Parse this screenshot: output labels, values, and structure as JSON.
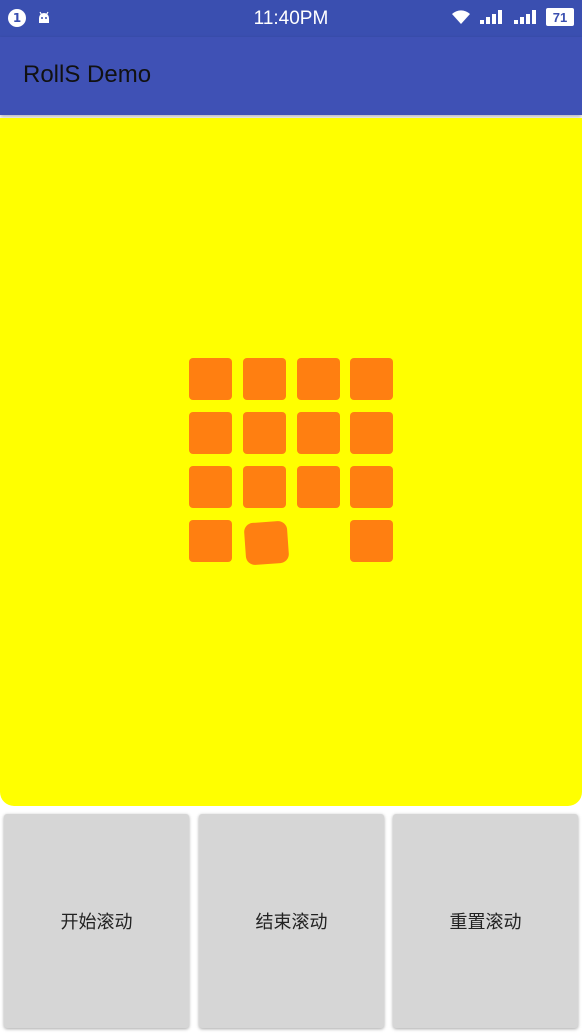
{
  "status_bar": {
    "notification_count": "1",
    "time": "11:40PM",
    "battery": "71",
    "icons": [
      "notification-badge",
      "android-icon",
      "wifi-icon",
      "signal-icon",
      "signal-icon",
      "battery-icon"
    ]
  },
  "app_bar": {
    "title": "RollS Demo"
  },
  "colors": {
    "status_bar": "#3a4fb0",
    "app_bar": "#3f51b5",
    "canvas": "#ffff00",
    "tile": "#ff7f11",
    "button": "#d6d6d6"
  },
  "grid": {
    "rows": 4,
    "columns": 4,
    "empty_cell": "row 4, column 3",
    "rolling_cell": "row 4, column 2"
  },
  "buttons": {
    "start": "开始滚动",
    "stop": "结束滚动",
    "reset": "重置滚动"
  }
}
